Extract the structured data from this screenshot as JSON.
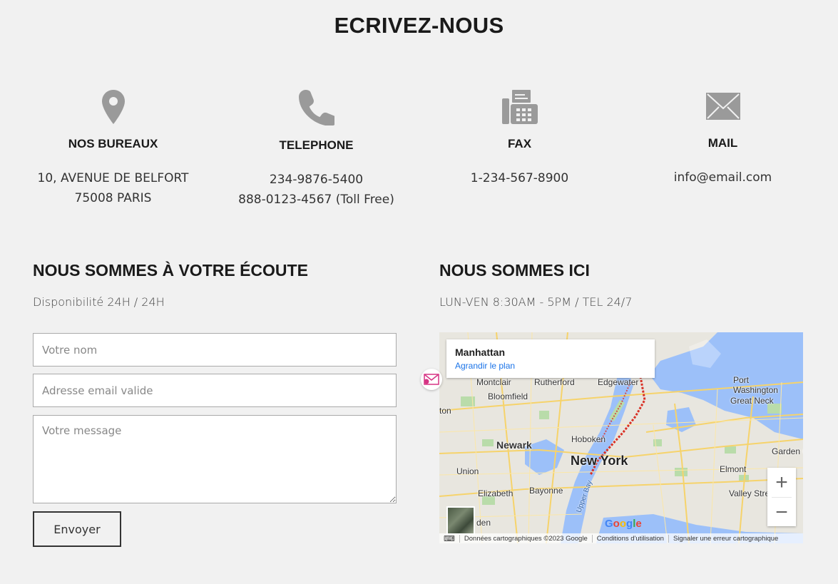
{
  "page_title": "ECRIVEZ-NOUS",
  "info": [
    {
      "label": "NOS BUREAUX",
      "lines": [
        "10, AVENUE DE BELFORT",
        "75008 PARIS"
      ],
      "icon": "map-pin-icon"
    },
    {
      "label": "TELEPHONE",
      "lines": [
        "234-9876-5400",
        "888-0123-4567 (Toll Free)"
      ],
      "icon": "phone-icon"
    },
    {
      "label": "FAX",
      "lines": [
        "1-234-567-8900"
      ],
      "icon": "fax-icon"
    },
    {
      "label": "MAIL",
      "lines": [
        "info@email.com"
      ],
      "icon": "envelope-icon"
    }
  ],
  "contact": {
    "title": "NOUS SOMMES À VOTRE ÉCOUTE",
    "subtitle": "Disponibilité 24H / 24H",
    "name_placeholder": "Votre nom",
    "email_placeholder": "Adresse email valide",
    "message_placeholder": "Votre message",
    "submit_label": "Envoyer"
  },
  "location": {
    "title": "NOUS SOMMES ICI",
    "subtitle": "LUN-VEN 8:30AM - 5PM / TEL  24/7"
  },
  "map": {
    "place_name": "Manhattan",
    "enlarge_link": "Agrandir le plan",
    "labels": {
      "montclair": "Montclair",
      "rutherford": "Rutherford",
      "edgewater": "Edgewater",
      "bloomfield": "Bloomfield",
      "port_washington": "Port\nWashington",
      "great_neck": "Great Neck",
      "newark": "Newark",
      "hoboken": "Hoboken",
      "new_york": "New York",
      "union": "Union",
      "elizabeth": "Elizabeth",
      "bayonne": "Bayonne",
      "upper_bay": "Upper Bay",
      "garden": "Garden C",
      "elmont": "Elmont",
      "valley_stream": "Valley Stre",
      "ton": "ton",
      "den": "den"
    },
    "google": "Google",
    "footer": [
      "Données cartographiques ©2023 Google",
      "Conditions d'utilisation",
      "Signaler une erreur cartographique"
    ],
    "zoom_in": "+",
    "zoom_out": "−"
  },
  "colors": {
    "icon_gray": "#9a9a9a",
    "water": "#9cc0f9",
    "land": "#e8e6df",
    "road": "#f6d36b",
    "park": "#b9dcaa",
    "route": "#d93025"
  }
}
